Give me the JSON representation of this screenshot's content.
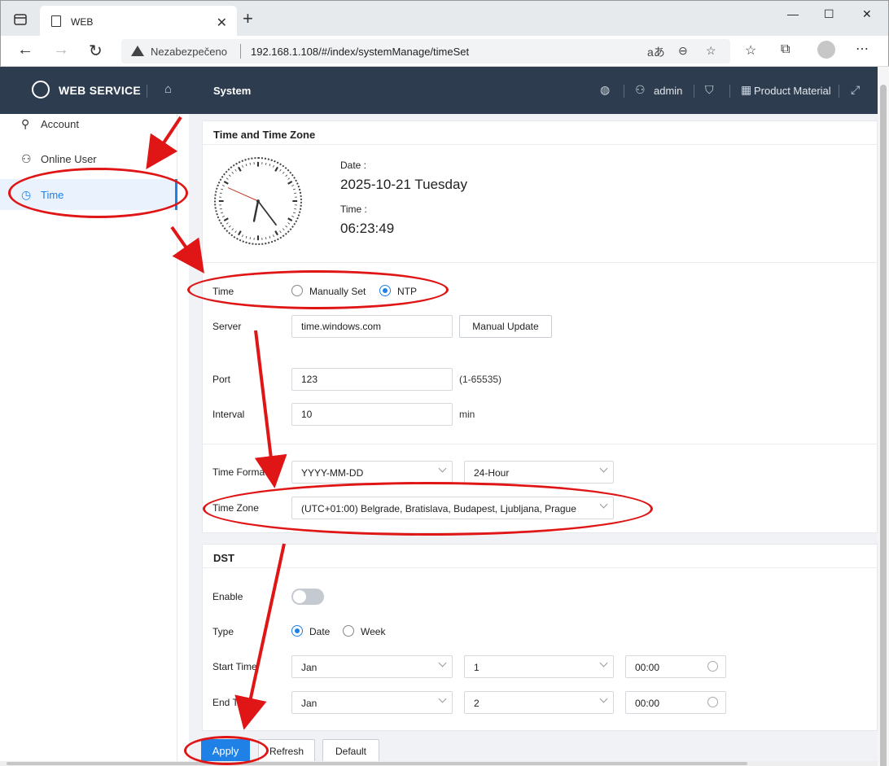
{
  "browser": {
    "tab_title": "WEB",
    "insecure_label": "Nezabezpečeno",
    "url": "192.168.1.108/#/index/systemManage/timeSet",
    "new_tab": "+",
    "minimize": "—",
    "maximize": "☐",
    "close": "✕"
  },
  "header": {
    "brand": "WEB SERVICE",
    "section": "System",
    "user": "admin",
    "product_material": "Product Material"
  },
  "sidebar": {
    "items": [
      {
        "label": "Account",
        "icon": "account-icon"
      },
      {
        "label": "Online User",
        "icon": "user-icon"
      },
      {
        "label": "Time",
        "icon": "clock-icon"
      }
    ]
  },
  "time_panel": {
    "title": "Time and Time Zone",
    "date_label": "Date :",
    "date_value": "2025-10-21 Tuesday",
    "time_label": "Time :",
    "time_value": "06:23:49",
    "clock": {
      "hour": 6,
      "minute": 23,
      "second": 49
    }
  },
  "ntp": {
    "time_label": "Time",
    "option_manual": "Manually Set",
    "option_ntp": "NTP",
    "selected": "NTP",
    "server_label": "Server",
    "server_value": "time.windows.com",
    "manual_update": "Manual Update",
    "port_label": "Port",
    "port_value": "123",
    "port_hint": "(1-65535)",
    "interval_label": "Interval",
    "interval_value": "10",
    "interval_unit": "min"
  },
  "format": {
    "time_format_label": "Time Forma",
    "date_format": "YYYY-MM-DD",
    "hour_format": "24-Hour",
    "time_zone_label": "Time Zone",
    "time_zone_value": "(UTC+01:00) Belgrade, Bratislava, Budapest, Ljubljana, Prague"
  },
  "dst": {
    "title": "DST",
    "enable_label": "Enable",
    "enabled": false,
    "type_label": "Type",
    "type_date": "Date",
    "type_week": "Week",
    "selected_type": "Date",
    "start_label": "Start Time",
    "start_month": "Jan",
    "start_day": "1",
    "start_time": "00:00",
    "end_label": "End Ti",
    "end_month": "Jan",
    "end_day": "2",
    "end_time": "00:00"
  },
  "actions": {
    "apply": "Apply",
    "refresh": "Refresh",
    "default": "Default"
  },
  "colors": {
    "accent": "#1f80e6",
    "header_bg": "#2d3d4f",
    "annotation": "#e01515"
  }
}
